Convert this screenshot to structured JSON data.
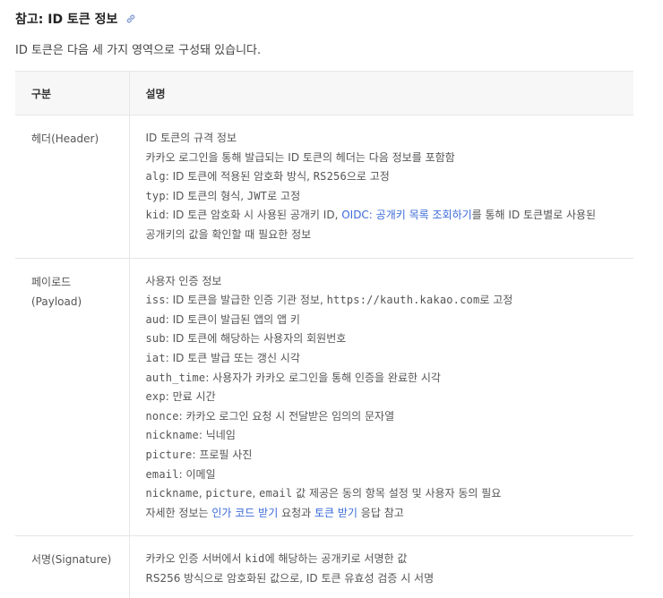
{
  "heading": {
    "title": "참고: ID 토큰 정보",
    "icon": "link-icon"
  },
  "intro": "ID 토큰은 다음 세 가지 영역으로 구성돼 있습니다.",
  "table": {
    "headers": [
      "구분",
      "설명"
    ],
    "rows": [
      {
        "label": [
          "헤더(Header)"
        ],
        "lines": [
          [
            {
              "t": "ID 토큰의 규격 정보"
            }
          ],
          [
            {
              "t": "카카오 로그인을 통해 발급되는 ID 토큰의 헤더는 다음 정보를 포함함"
            }
          ],
          [
            {
              "t": "alg",
              "c": 1
            },
            {
              "t": ": ID 토큰에 적용된 암호화 방식, "
            },
            {
              "t": "RS256",
              "c": 1
            },
            {
              "t": "으로 고정"
            }
          ],
          [
            {
              "t": "typ",
              "c": 1
            },
            {
              "t": ": ID 토큰의 형식, "
            },
            {
              "t": "JWT",
              "c": 1
            },
            {
              "t": "로 고정"
            }
          ],
          [
            {
              "t": "kid",
              "c": 1
            },
            {
              "t": ": ID 토큰 암호화 시 사용된 공개키 ID, "
            },
            {
              "t": "OIDC: 공개키 목록 조회하기",
              "l": 1
            },
            {
              "t": "를 통해 ID 토큰별로 사용된"
            }
          ],
          [
            {
              "t": "공개키의 값을 확인할 때 필요한 정보"
            }
          ]
        ]
      },
      {
        "label": [
          "페이로드",
          "(Payload)"
        ],
        "lines": [
          [
            {
              "t": "사용자 인증 정보"
            }
          ],
          [
            {
              "t": "iss",
              "c": 1
            },
            {
              "t": ": ID 토큰을 발급한 인증 기관 정보, "
            },
            {
              "t": "https://kauth.kakao.com",
              "c": 1
            },
            {
              "t": "로 고정"
            }
          ],
          [
            {
              "t": "aud",
              "c": 1
            },
            {
              "t": ": ID 토큰이 발급된 앱의 앱 키"
            }
          ],
          [
            {
              "t": "sub",
              "c": 1
            },
            {
              "t": ": ID 토큰에 해당하는 사용자의 회원번호"
            }
          ],
          [
            {
              "t": "iat",
              "c": 1
            },
            {
              "t": ": ID 토큰 발급 또는 갱신 시각"
            }
          ],
          [
            {
              "t": "auth_time",
              "c": 1
            },
            {
              "t": ": 사용자가 카카오 로그인을 통해 인증을 완료한 시각"
            }
          ],
          [
            {
              "t": "exp",
              "c": 1
            },
            {
              "t": ": 만료 시간"
            }
          ],
          [
            {
              "t": "nonce",
              "c": 1
            },
            {
              "t": ": 카카오 로그인 요청 시 전달받은 임의의 문자열"
            }
          ],
          [
            {
              "t": "nickname",
              "c": 1
            },
            {
              "t": ": 닉네임"
            }
          ],
          [
            {
              "t": "picture",
              "c": 1
            },
            {
              "t": ": 프로필 사진"
            }
          ],
          [
            {
              "t": "email",
              "c": 1
            },
            {
              "t": ": 이메일"
            }
          ],
          [
            {
              "t": "nickname",
              "c": 1
            },
            {
              "t": ", "
            },
            {
              "t": "picture",
              "c": 1
            },
            {
              "t": ", "
            },
            {
              "t": "email",
              "c": 1
            },
            {
              "t": " 값 제공은 동의 항목 설정 및 사용자 동의 필요"
            }
          ],
          [
            {
              "t": "자세한 정보는 "
            },
            {
              "t": "인가 코드 받기",
              "l": 1
            },
            {
              "t": " 요청과 "
            },
            {
              "t": "토큰 받기",
              "l": 1
            },
            {
              "t": " 응답 참고"
            }
          ]
        ]
      },
      {
        "label": [
          "서명(Signature)"
        ],
        "lines": [
          [
            {
              "t": "카카오 인증 서버에서 "
            },
            {
              "t": "kid",
              "c": 1
            },
            {
              "t": "에 해당하는 공개키로 서명한 값"
            }
          ],
          [
            {
              "t": "RS256 방식으로 암호화된 값으로, ID 토큰 유효성 검증 시 서명"
            }
          ]
        ]
      }
    ]
  }
}
